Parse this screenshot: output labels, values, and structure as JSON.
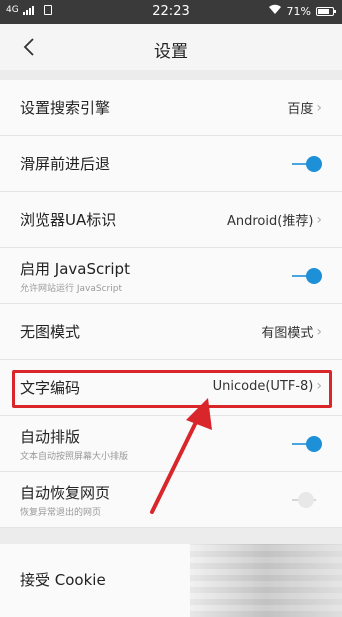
{
  "status_bar": {
    "network": "4G",
    "time": "22:23",
    "battery": "71%"
  },
  "header": {
    "title": "设置"
  },
  "settings": {
    "search_engine": {
      "label": "设置搜索引擎",
      "value": "百度"
    },
    "swipe_nav": {
      "label": "滑屏前进后退",
      "on": true
    },
    "ua": {
      "label": "浏览器UA标识",
      "value": "Android(推荐)"
    },
    "javascript": {
      "label": "启用 JavaScript",
      "sub": "允许网站运行 JavaScript",
      "on": true
    },
    "no_image": {
      "label": "无图模式",
      "value": "有图模式"
    },
    "encoding": {
      "label": "文字编码",
      "value": "Unicode(UTF-8)"
    },
    "auto_layout": {
      "label": "自动排版",
      "sub": "文本自动按照屏幕大小排版",
      "on": true
    },
    "auto_restore": {
      "label": "自动恢复网页",
      "sub": "恢复异常退出的网页",
      "on": false
    }
  },
  "cookie": {
    "label": "接受 Cookie"
  },
  "colors": {
    "accent": "#1e90d8",
    "highlight": "#d9262b"
  }
}
